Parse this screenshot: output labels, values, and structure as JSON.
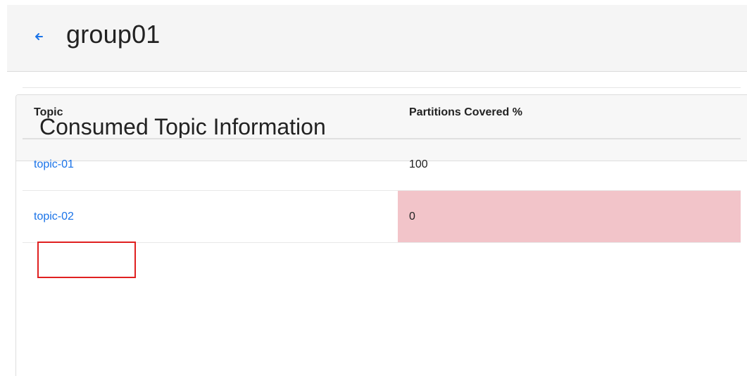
{
  "header": {
    "group_name": "group01",
    "back_icon": "arrow-left-icon"
  },
  "card": {
    "title": "Consumed Topic Information"
  },
  "table": {
    "columns": [
      "Topic",
      "Partitions Covered %"
    ],
    "rows": [
      {
        "topic": "topic-01",
        "partitions_covered": "100",
        "status": "normal",
        "highlighted": true
      },
      {
        "topic": "topic-02",
        "partitions_covered": "0",
        "status": "danger",
        "highlighted": false
      }
    ]
  },
  "colors": {
    "link": "#1a73e8",
    "danger_cell": "#f2c4c9",
    "highlight_border": "#e02020"
  }
}
